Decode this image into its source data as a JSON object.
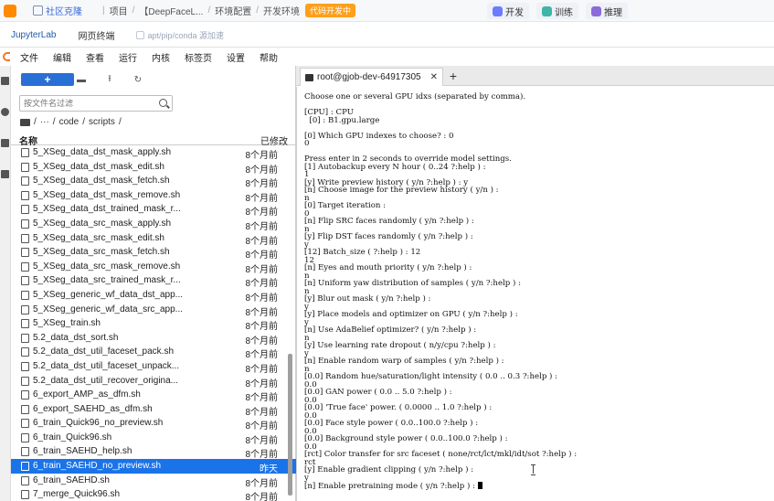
{
  "platform": {
    "breadcrumbs": [
      "社区克隆",
      "项目",
      "【DeepFaceL...",
      "环境配置",
      "开发环境"
    ],
    "dev_badge": "代码开发中",
    "modes": [
      {
        "label": "开发",
        "color": "#6b7cff"
      },
      {
        "label": "训练",
        "color": "#3fb5a8"
      },
      {
        "label": "推理",
        "color": "#8a6bd8"
      }
    ]
  },
  "jupyter_tabs": {
    "app": "JupyterLab",
    "terminal": "网页终端",
    "pip": "apt/pip/conda 源加速"
  },
  "menu": [
    "文件",
    "编辑",
    "查看",
    "运行",
    "内核",
    "标签页",
    "设置",
    "帮助"
  ],
  "filebrowser": {
    "new_button": "+",
    "filter_placeholder": "按文件名过滤",
    "path": [
      "/",
      "···",
      "/",
      "code",
      "/",
      "scripts",
      "/"
    ],
    "col_name": "名称",
    "col_modified": "已修改",
    "files": [
      {
        "name": "5_XSeg_data_dst_mask_apply.sh",
        "modified": "8个月前"
      },
      {
        "name": "5_XSeg_data_dst_mask_edit.sh",
        "modified": "8个月前"
      },
      {
        "name": "5_XSeg_data_dst_mask_fetch.sh",
        "modified": "8个月前"
      },
      {
        "name": "5_XSeg_data_dst_mask_remove.sh",
        "modified": "8个月前"
      },
      {
        "name": "5_XSeg_data_dst_trained_mask_r...",
        "modified": "8个月前"
      },
      {
        "name": "5_XSeg_data_src_mask_apply.sh",
        "modified": "8个月前"
      },
      {
        "name": "5_XSeg_data_src_mask_edit.sh",
        "modified": "8个月前"
      },
      {
        "name": "5_XSeg_data_src_mask_fetch.sh",
        "modified": "8个月前"
      },
      {
        "name": "5_XSeg_data_src_mask_remove.sh",
        "modified": "8个月前"
      },
      {
        "name": "5_XSeg_data_src_trained_mask_r...",
        "modified": "8个月前"
      },
      {
        "name": "5_XSeg_generic_wf_data_dst_app...",
        "modified": "8个月前"
      },
      {
        "name": "5_XSeg_generic_wf_data_src_app...",
        "modified": "8个月前"
      },
      {
        "name": "5_XSeg_train.sh",
        "modified": "8个月前"
      },
      {
        "name": "5.2_data_dst_sort.sh",
        "modified": "8个月前"
      },
      {
        "name": "5.2_data_dst_util_faceset_pack.sh",
        "modified": "8个月前"
      },
      {
        "name": "5.2_data_dst_util_faceset_unpack...",
        "modified": "8个月前"
      },
      {
        "name": "5.2_data_dst_util_recover_origina...",
        "modified": "8个月前"
      },
      {
        "name": "6_export_AMP_as_dfm.sh",
        "modified": "8个月前"
      },
      {
        "name": "6_export_SAEHD_as_dfm.sh",
        "modified": "8个月前"
      },
      {
        "name": "6_train_Quick96_no_preview.sh",
        "modified": "8个月前"
      },
      {
        "name": "6_train_Quick96.sh",
        "modified": "8个月前"
      },
      {
        "name": "6_train_SAEHD_help.sh",
        "modified": "8个月前"
      },
      {
        "name": "6_train_SAEHD_no_preview.sh",
        "modified": "昨天",
        "selected": true
      },
      {
        "name": "6_train_SAEHD.sh",
        "modified": "8个月前"
      },
      {
        "name": "7_merge_Quick96.sh",
        "modified": "8个月前"
      }
    ]
  },
  "terminal": {
    "tab_title": "root@gjob-dev-64917305",
    "lines": [
      "Choose one or several GPU idxs (separated by comma).",
      "",
      "[CPU] : CPU",
      "  [0] : B1.gpu.large",
      "",
      "[0] Which GPU indexes to choose? : 0",
      "0",
      "",
      "Press enter in 2 seconds to override model settings.",
      "[1] Autobackup every N hour ( 0..24 ?:help ) :",
      "1",
      "[y] Write preview history ( y/n ?:help ) : y",
      "[n] Choose image for the preview history ( y/n ) :",
      "n",
      "[0] Target iteration :",
      "0",
      "[n] Flip SRC faces randomly ( y/n ?:help ) :",
      "n",
      "[y] Flip DST faces randomly ( y/n ?:help ) :",
      "y",
      "[12] Batch_size ( ?:help ) : 12",
      "12",
      "[n] Eyes and mouth priority ( y/n ?:help ) :",
      "n",
      "[n] Uniform yaw distribution of samples ( y/n ?:help ) :",
      "n",
      "[y] Blur out mask ( y/n ?:help ) :",
      "y",
      "[y] Place models and optimizer on GPU ( y/n ?:help ) :",
      "y",
      "[n] Use AdaBelief optimizer? ( y/n ?:help ) :",
      "n",
      "[y] Use learning rate dropout ( n/y/cpu ?:help ) :",
      "y",
      "[n] Enable random warp of samples ( y/n ?:help ) :",
      "n",
      "[0.0] Random hue/saturation/light intensity ( 0.0 .. 0.3 ?:help ) :",
      "0.0",
      "[0.0] GAN power ( 0.0 .. 5.0 ?:help ) :",
      "0.0",
      "[0.0] 'True face' power. ( 0.0000 .. 1.0 ?:help ) :",
      "0.0",
      "[0.0] Face style power ( 0.0..100.0 ?:help ) :",
      "0.0",
      "[0.0] Background style power ( 0.0..100.0 ?:help ) :",
      "0.0",
      "[rct] Color transfer for src faceset ( none/rct/lct/mkl/idt/sot ?:help ) :",
      "rct",
      "[y] Enable gradient clipping ( y/n ?:help ) :",
      "y",
      "[n] Enable pretraining mode ( y/n ?:help ) : "
    ]
  }
}
